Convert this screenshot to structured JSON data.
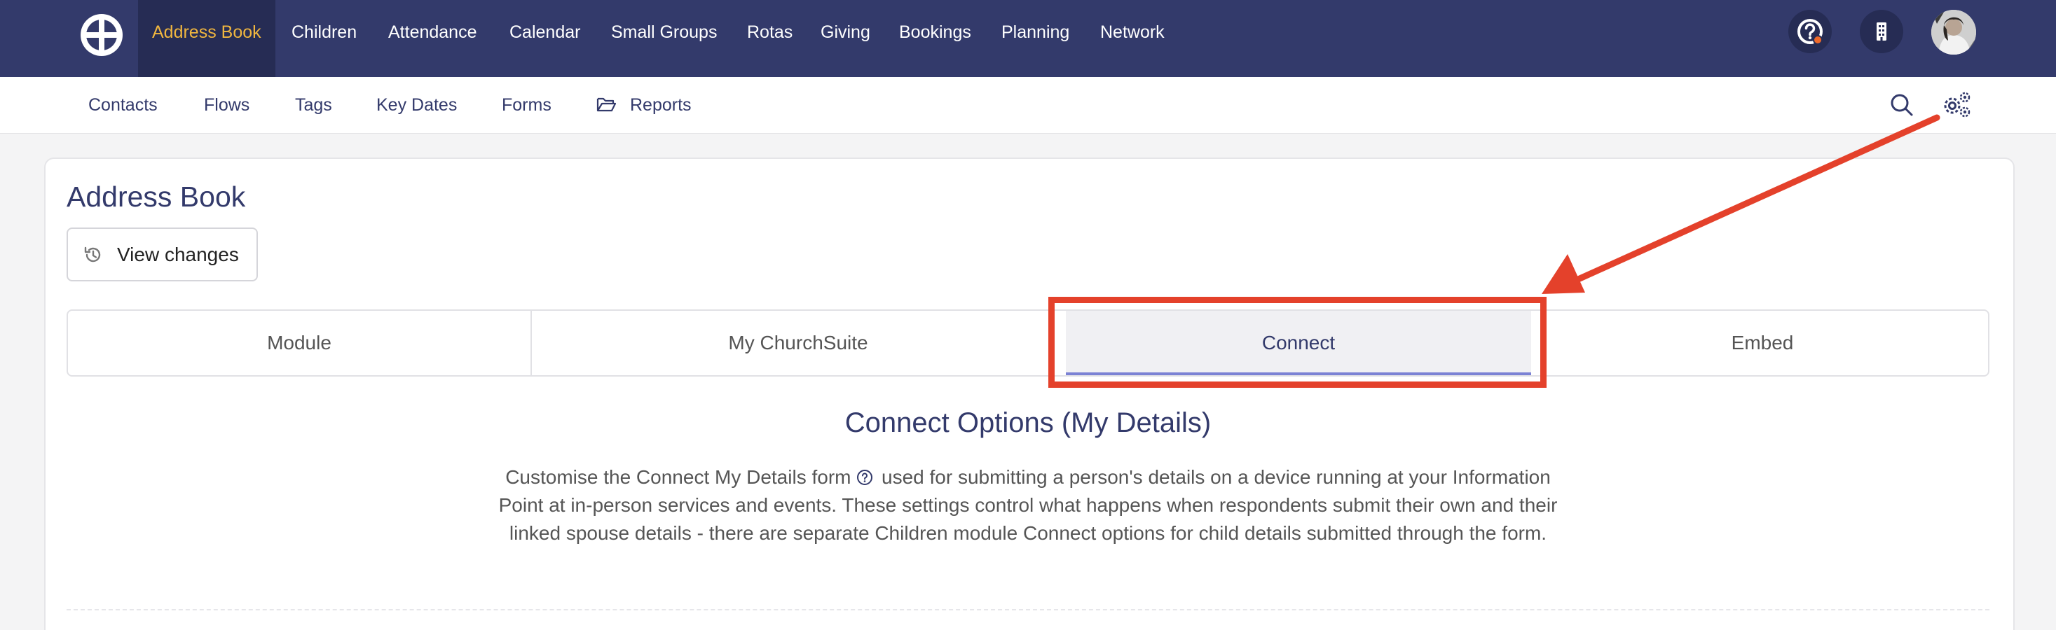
{
  "top_nav": {
    "items": [
      {
        "label": "Address Book",
        "active": true
      },
      {
        "label": "Children"
      },
      {
        "label": "Attendance"
      },
      {
        "label": "Calendar"
      },
      {
        "label": "Small Groups"
      },
      {
        "label": "Rotas"
      },
      {
        "label": "Giving"
      },
      {
        "label": "Bookings"
      },
      {
        "label": "Planning"
      },
      {
        "label": "Network"
      }
    ],
    "right_icons": [
      "help-icon",
      "building-icon",
      "avatar"
    ]
  },
  "sub_nav": {
    "items": [
      {
        "label": "Contacts"
      },
      {
        "label": "Flows"
      },
      {
        "label": "Tags"
      },
      {
        "label": "Key Dates"
      },
      {
        "label": "Forms"
      },
      {
        "label": "Reports",
        "icon": "folder-icon"
      }
    ],
    "right_icons": [
      "search-icon",
      "gears-icon"
    ]
  },
  "page": {
    "title": "Address Book",
    "view_changes_label": "View changes"
  },
  "tabs": [
    {
      "label": "Module"
    },
    {
      "label": "My ChurchSuite"
    },
    {
      "label": "Connect",
      "active": true
    },
    {
      "label": "Embed"
    }
  ],
  "section": {
    "title": "Connect Options (My Details)",
    "desc_part1": "Customise the Connect My Details form",
    "desc_part2": " used for submitting a person's details on a device running at your Information Point at in-person services and events. These settings control what happens when respondents submit their own and their linked spouse details - there are separate Children module Connect options for child details submitted through the form."
  },
  "colors": {
    "nav_bg": "#333a6b",
    "nav_active_bg": "#262c54",
    "nav_active_text": "#f0b63f",
    "brand_text": "#333a6b",
    "annotation_red": "#e4412b",
    "tab_active_underline": "#7b82d4"
  }
}
